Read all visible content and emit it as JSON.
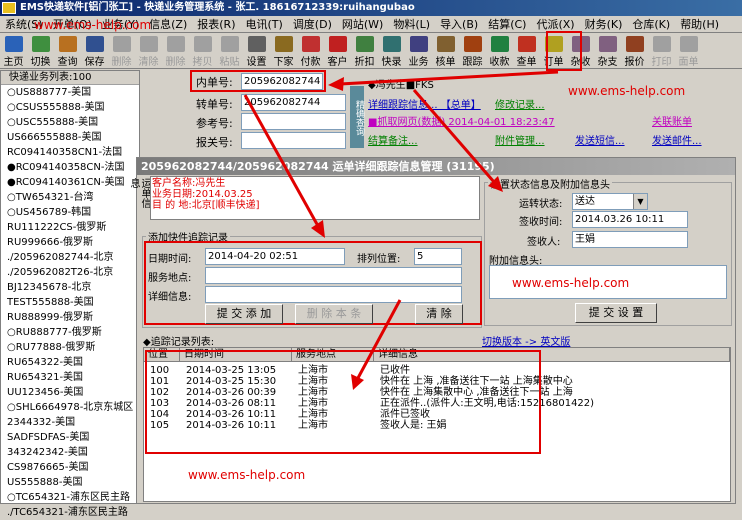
{
  "window": {
    "title": "EMS快递软件[铝门张工] - 快递业务管理系统 - 张工. 18616712339:ruihangubao"
  },
  "menu": [
    "系统(S)",
    "开单(O)",
    "业务(Y)",
    "信息(Z)",
    "报表(R)",
    "电讯(T)",
    "调度(D)",
    "网站(W)",
    "物料(L)",
    "导入(B)",
    "结算(C)",
    "代派(X)",
    "财务(K)",
    "仓库(K)",
    "帮助(H)"
  ],
  "toolbar": [
    {
      "label": "主页",
      "icon": "home-icon",
      "color": "#2a62b8",
      "disabled": false
    },
    {
      "label": "切换",
      "icon": "switch-icon",
      "color": "#3f8f3f",
      "disabled": false
    },
    {
      "label": "查询",
      "icon": "query-icon",
      "color": "#b87020",
      "disabled": false
    },
    {
      "label": "保存",
      "icon": "save-icon",
      "color": "#305090",
      "disabled": false
    },
    {
      "label": "删除",
      "icon": "delete-icon",
      "color": "#a0a0a0",
      "disabled": true
    },
    {
      "label": "清除",
      "icon": "clear-icon",
      "color": "#a0a0a0",
      "disabled": true
    },
    {
      "label": "删除",
      "icon": "delete2-icon",
      "color": "#a0a0a0",
      "disabled": true
    },
    {
      "label": "拷贝",
      "icon": "copy-icon",
      "color": "#a0a0a0",
      "disabled": true
    },
    {
      "label": "粘贴",
      "icon": "paste-icon",
      "color": "#a0a0a0",
      "disabled": true
    },
    {
      "label": "设置",
      "icon": "settings-icon",
      "color": "#606060",
      "disabled": false
    },
    {
      "label": "下家",
      "icon": "next-icon",
      "color": "#8a6a20",
      "disabled": false
    },
    {
      "label": "付款",
      "icon": "pay-icon",
      "color": "#c03030",
      "disabled": false
    },
    {
      "label": "客户",
      "icon": "customer-icon",
      "color": "#c02020",
      "disabled": false
    },
    {
      "label": "折扣",
      "icon": "discount-icon",
      "color": "#408040",
      "disabled": false
    },
    {
      "label": "快录",
      "icon": "quick-entry-icon",
      "color": "#307070",
      "disabled": false
    },
    {
      "label": "业务",
      "icon": "business-icon",
      "color": "#404080",
      "disabled": false
    },
    {
      "label": "核单",
      "icon": "check-icon",
      "color": "#806030",
      "disabled": false
    },
    {
      "label": "跟踪",
      "icon": "track-icon",
      "color": "#a04010",
      "disabled": false
    },
    {
      "label": "收款",
      "icon": "collect-icon",
      "color": "#208040",
      "disabled": false
    },
    {
      "label": "查单",
      "icon": "search-order-icon",
      "color": "#c03020",
      "disabled": false
    },
    {
      "label": "订单",
      "icon": "order-icon",
      "color": "#b0a020",
      "disabled": false
    },
    {
      "label": "杂收",
      "icon": "misc-in-icon",
      "color": "#806080",
      "disabled": false
    },
    {
      "label": "杂支",
      "icon": "misc-out-icon",
      "color": "#806080",
      "disabled": false
    },
    {
      "label": "报价",
      "icon": "quote-icon",
      "color": "#904020",
      "disabled": false
    },
    {
      "label": "打印",
      "icon": "print-icon",
      "color": "#a0a0a0",
      "disabled": true
    },
    {
      "label": "面单",
      "icon": "waybill-icon",
      "color": "#a0a0a0",
      "disabled": true
    }
  ],
  "sidebar": {
    "header": "快递业务列表:100",
    "items": [
      "○US888777-美国",
      "○CSUS555888-美国",
      "○USC555888-美国",
      "US666555888-美国",
      "RC094140358CN1-法国",
      "●RC094140358CN-法国",
      "●RC094140361CN-美国",
      "○TW654321-台湾",
      "○US456789-韩国",
      "RU111222CS-俄罗斯",
      "RU999666-俄罗斯",
      "./205962082744-北京",
      "./205962082T26-北京",
      "BJ12345678-北京",
      "TEST555888-美国",
      "RU888999-俄罗斯",
      "○RU888777-俄罗斯",
      "○RU77888-俄罗斯",
      "RU654322-美国",
      "RU654321-美国",
      "UU123456-美国",
      "○SHL6664978-北京东城区",
      "2344332-美国",
      "SADFSDFAS-美国",
      "343242342-美国",
      "CS9876665-美国",
      "US555888-美国",
      "○TC654321-浦东区民主路",
      "./TC654321-浦东区民主路"
    ]
  },
  "form": {
    "inner_no_label": "内单号:",
    "inner_no": "205962082744",
    "trans_no_label": "转单号:",
    "trans_no": "205962082744",
    "ref_no_label": "参考号:",
    "declare_no_label": "报关号:",
    "customer_line": "◆冯先生■FKS",
    "vtab": "精确查询",
    "link_detail": "详细跟踪信息... 【总单】",
    "link_modify": "修改记录...",
    "link_fetch": "■抓取网页(数据) 2014-04-01 18:23:47",
    "link_related": "关联账单",
    "link_settle": "结算备注...",
    "link_attach": "附件管理...",
    "link_sms": "发送短信...",
    "link_mail": "发送邮件..."
  },
  "dialog": {
    "title": "205962082744/205962082744 运单详细跟踪信息管理 (31195)",
    "side_tab": "运单信息",
    "cust_name": "客户名称:冯先生",
    "biz_date": "业务日期:2014.03.25",
    "dest": "目 的 地:北京[顺丰快递]",
    "add_group": "添加快件追踪记录",
    "time_label": "日期时间:",
    "time_value": "2014-04-20 02:51",
    "pos_label": "排列位置:",
    "pos_value": "5",
    "place_label": "服务地点:",
    "detail_label": "详细信息:",
    "btn_submit": "提 交 添 加",
    "btn_delete": "删 除 本 条",
    "btn_clear": "清 除",
    "status_group": "设置状态信息及附加信息头",
    "ship_status_label": "运转状态:",
    "ship_status": "送达",
    "sign_time_label": "签收时间:",
    "sign_time": "2014.03.26 10:11",
    "signer_label": "签收人:",
    "signer": "王娟",
    "extra_label": "附加信息头:",
    "btn_set": "提 交 设 置",
    "list_title": "◆追踪记录列表:",
    "switch_link": "切换版本 -> 英文版"
  },
  "table": {
    "columns": [
      "位置",
      "日期时间",
      "服务地点",
      "详细信息"
    ],
    "rows": [
      [
        "100",
        "2014-03-25 13:05",
        "上海市",
        "已收件"
      ],
      [
        "101",
        "2014-03-25 15:30",
        "上海市",
        "快件在 上海 ,准备送往下一站 上海集散中心"
      ],
      [
        "102",
        "2014-03-26 00:39",
        "上海市",
        "快件在 上海集散中心 ,准备送往下一站 上海"
      ],
      [
        "103",
        "2014-03-26 08:11",
        "上海市",
        "正在派件..(派件人:王文明,电话:15216801422)"
      ],
      [
        "104",
        "2014-03-26 10:11",
        "上海市",
        "派件已签收"
      ],
      [
        "105",
        "2014-03-26 10:11",
        "上海市",
        "签收人是: 王娟"
      ]
    ]
  },
  "watermark": "www.ems-help.com"
}
